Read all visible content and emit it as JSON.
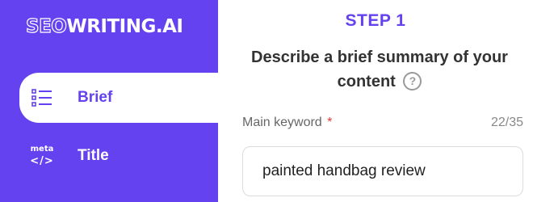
{
  "brand": {
    "logo_outline": "SEO",
    "logo_solid": "WRITING.AI",
    "accent_color": "#6542ef"
  },
  "sidebar": {
    "items": [
      {
        "label": "Brief",
        "icon": "list-icon",
        "active": true
      },
      {
        "label": "Title",
        "icon": "meta-code-icon",
        "icon_text_top": "meta",
        "icon_text_bottom": "</>",
        "active": false
      }
    ]
  },
  "main": {
    "step_label": "STEP 1",
    "headline": "Describe a brief summary of your content",
    "help_icon_glyph": "?",
    "field": {
      "label": "Main keyword",
      "required_mark": "*",
      "char_count": "22/35",
      "value": "painted handbag review"
    }
  }
}
